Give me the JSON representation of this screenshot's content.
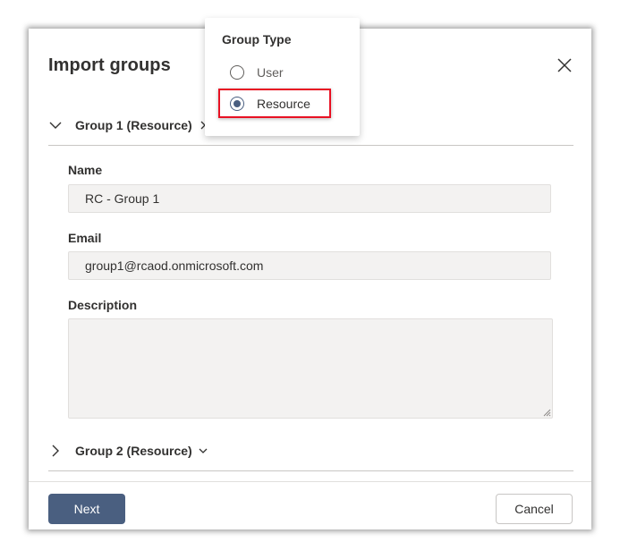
{
  "dialog": {
    "title": "Import groups",
    "close_icon": "close-icon"
  },
  "groups": [
    {
      "header": "Group 1 (Resource)",
      "expanded": true,
      "fields": {
        "name_label": "Name",
        "name_value": "RC - Group 1",
        "email_label": "Email",
        "email_value": "group1@rcaod.onmicrosoft.com",
        "description_label": "Description",
        "description_value": ""
      }
    },
    {
      "header": "Group 2 (Resource)",
      "expanded": false
    }
  ],
  "popup": {
    "title": "Group Type",
    "options": [
      {
        "label": "User",
        "selected": false
      },
      {
        "label": "Resource",
        "selected": true
      }
    ]
  },
  "footer": {
    "next_label": "Next",
    "cancel_label": "Cancel"
  },
  "colors": {
    "primary": "#4a5f80",
    "highlight": "#e81123",
    "field_bg": "#f3f2f1"
  }
}
